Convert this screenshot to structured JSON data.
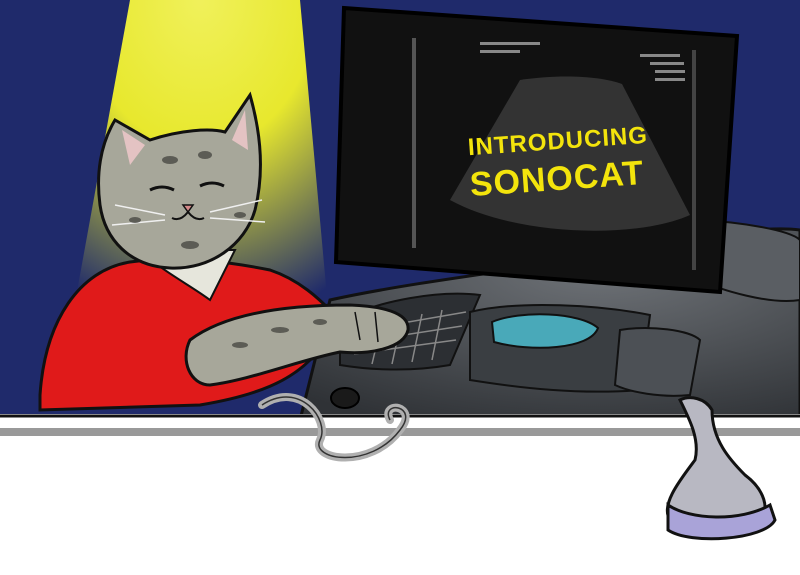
{
  "monitor_screen": {
    "title_line1": "INTRODUCING",
    "title_line2": "SONOCAT"
  },
  "colors": {
    "background": "#1f2a6b",
    "spotlight": "#f2f22a",
    "cat_shirt": "#e01a1a",
    "cat_fur": "#a7a79a",
    "screen": "#111111",
    "screen_text": "#f3e40c",
    "console": "#4b4f53",
    "trackball": "#49a9b9",
    "probe_head": "#a9a3d8",
    "table": "#ffffff"
  },
  "icons": [
    "cat-icon",
    "ultrasound-probe-icon",
    "keyboard-icon",
    "trackball-icon",
    "ultrasound-monitor-icon"
  ]
}
